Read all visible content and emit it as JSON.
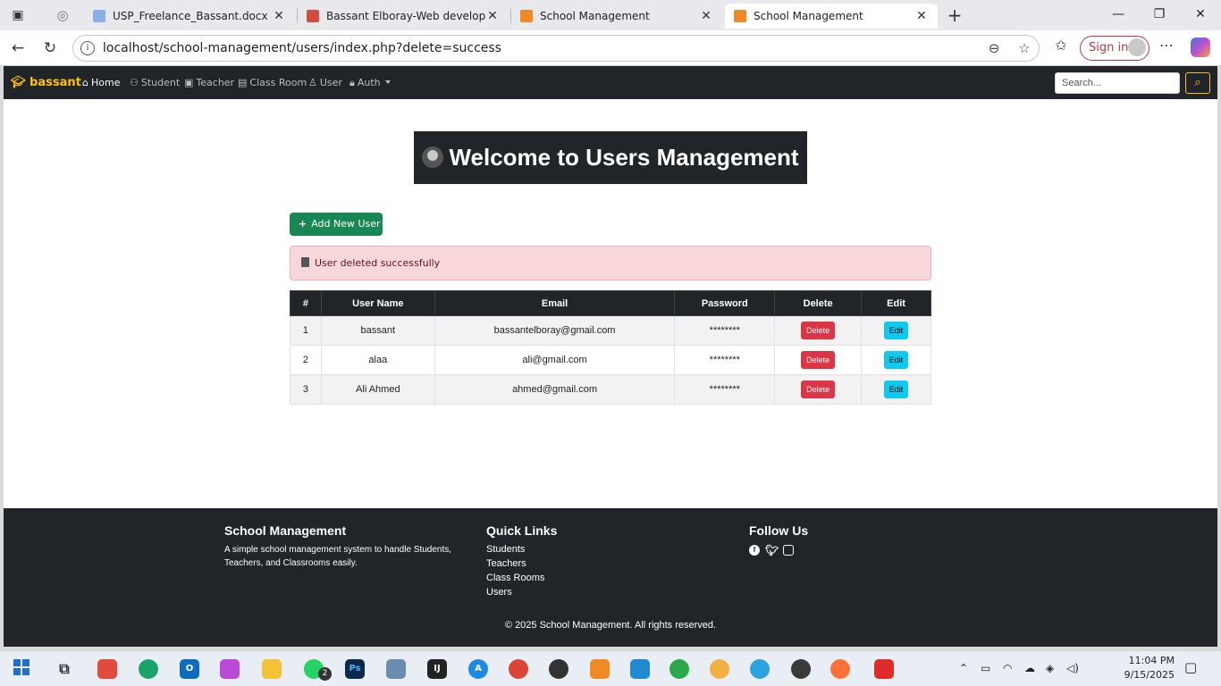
{
  "browser": {
    "tabs": [
      {
        "title": "USP_Freelance_Bassant.docx - الـ",
        "active": false
      },
      {
        "title": "Bassant Elboray-Web developer.p",
        "active": false
      },
      {
        "title": "School Management",
        "active": false
      },
      {
        "title": "School Management",
        "active": true
      }
    ],
    "url": "localhost/school-management/users/index.php?delete=success",
    "sign_in_label": "Sign in"
  },
  "navbar": {
    "brand": "bassant",
    "items": [
      {
        "label": "Home",
        "active": true
      },
      {
        "label": "Student"
      },
      {
        "label": "Teacher"
      },
      {
        "label": "Class Room"
      },
      {
        "label": "User"
      },
      {
        "label": "Auth"
      }
    ],
    "search_placeholder": "Search..."
  },
  "main": {
    "heading": "Welcome to Users Management",
    "add_button": "Add New User",
    "alert": "User deleted successfully",
    "table": {
      "headers": [
        "#",
        "User Name",
        "Email",
        "Password",
        "Delete",
        "Edit"
      ],
      "rows": [
        {
          "id": "1",
          "name": "bassant",
          "email": "bassantelboray@gmail.com",
          "password": "********"
        },
        {
          "id": "2",
          "name": "alaa",
          "email": "ali@gmail.com",
          "password": "********"
        },
        {
          "id": "3",
          "name": "Ali Ahmed",
          "email": "ahmed@gmail.com",
          "password": "********"
        }
      ],
      "delete_label": "Delete",
      "edit_label": "Edit"
    }
  },
  "footer": {
    "about_title": "School Management",
    "about_text": "A simple school management system to handle Students, Teachers, and Classrooms easily.",
    "links_title": "Quick Links",
    "links": [
      "Students",
      "Teachers",
      "Class Rooms",
      "Users"
    ],
    "follow_title": "Follow Us",
    "copyright": "© 2025 School Management. All rights reserved."
  },
  "taskbar": {
    "time": "11:04 PM",
    "date": "9/15/2025",
    "whatsapp_badge": "2"
  },
  "colors": {
    "dark": "#212529",
    "brand": "#ffc107",
    "success": "#198754",
    "danger": "#dc3545",
    "info": "#0dcaf0"
  }
}
